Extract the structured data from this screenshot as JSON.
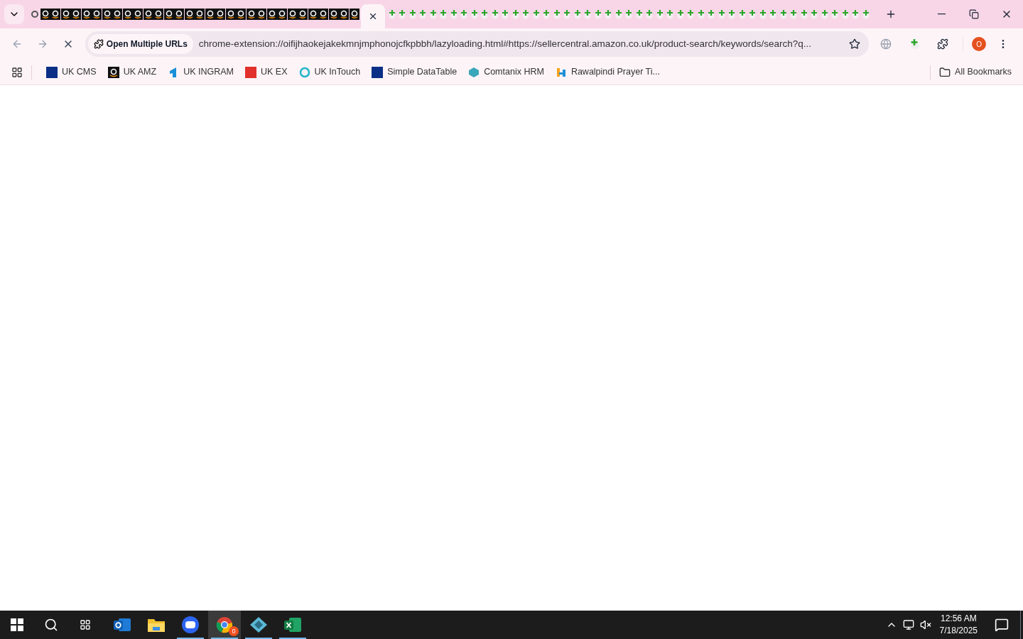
{
  "tab_strip": {
    "tabs": [
      {
        "kind": "chrome",
        "selected": false
      },
      {
        "kind": "amazon",
        "selected": false
      },
      {
        "kind": "amazon",
        "selected": false
      },
      {
        "kind": "amazon",
        "selected": false
      },
      {
        "kind": "amazon",
        "selected": false
      },
      {
        "kind": "amazon",
        "selected": false
      },
      {
        "kind": "amazon",
        "selected": false
      },
      {
        "kind": "amazon",
        "selected": false
      },
      {
        "kind": "amazon",
        "selected": false
      },
      {
        "kind": "amazon",
        "selected": false
      },
      {
        "kind": "amazon",
        "selected": false
      },
      {
        "kind": "amazon",
        "selected": false
      },
      {
        "kind": "amazon",
        "selected": false
      },
      {
        "kind": "amazon",
        "selected": false
      },
      {
        "kind": "amazon",
        "selected": false
      },
      {
        "kind": "amazon",
        "selected": false
      },
      {
        "kind": "amazon",
        "selected": false
      },
      {
        "kind": "amazon",
        "selected": false
      },
      {
        "kind": "amazon",
        "selected": false
      },
      {
        "kind": "amazon",
        "selected": false
      },
      {
        "kind": "amazon",
        "selected": false
      },
      {
        "kind": "amazon",
        "selected": false
      },
      {
        "kind": "amazon",
        "selected": false
      },
      {
        "kind": "amazon",
        "selected": false
      },
      {
        "kind": "amazon",
        "selected": false
      },
      {
        "kind": "amazon",
        "selected": false
      },
      {
        "kind": "amazon",
        "selected": false
      },
      {
        "kind": "amazon",
        "selected": false
      },
      {
        "kind": "amazon",
        "selected": false
      },
      {
        "kind": "amazon",
        "selected": false
      },
      {
        "kind": "amazon",
        "selected": false
      },
      {
        "kind": "amazon",
        "selected": false
      },
      {
        "selected": true
      },
      {
        "kind": "extension",
        "selected": false
      },
      {
        "kind": "extension",
        "selected": false
      },
      {
        "kind": "extension",
        "selected": false
      },
      {
        "kind": "extension",
        "selected": false
      },
      {
        "kind": "extension",
        "selected": false
      },
      {
        "kind": "extension",
        "selected": false
      },
      {
        "kind": "extension",
        "selected": false
      },
      {
        "kind": "extension",
        "selected": false
      },
      {
        "kind": "extension",
        "selected": false
      },
      {
        "kind": "extension",
        "selected": false
      },
      {
        "kind": "extension",
        "selected": false
      },
      {
        "kind": "extension",
        "selected": false
      },
      {
        "kind": "extension",
        "selected": false
      },
      {
        "kind": "extension",
        "selected": false
      },
      {
        "kind": "extension",
        "selected": false
      },
      {
        "kind": "extension",
        "selected": false
      },
      {
        "kind": "extension",
        "selected": false
      },
      {
        "kind": "extension",
        "selected": false
      },
      {
        "kind": "extension",
        "selected": false
      },
      {
        "kind": "extension",
        "selected": false
      },
      {
        "kind": "extension",
        "selected": false
      },
      {
        "kind": "extension",
        "selected": false
      },
      {
        "kind": "extension",
        "selected": false
      },
      {
        "kind": "extension",
        "selected": false
      },
      {
        "kind": "extension",
        "selected": false
      },
      {
        "kind": "extension",
        "selected": false
      },
      {
        "kind": "extension",
        "selected": false
      },
      {
        "kind": "extension",
        "selected": false
      },
      {
        "kind": "extension",
        "selected": false
      },
      {
        "kind": "extension",
        "selected": false
      },
      {
        "kind": "extension",
        "selected": false
      },
      {
        "kind": "extension",
        "selected": false
      },
      {
        "kind": "extension",
        "selected": false
      },
      {
        "kind": "extension",
        "selected": false
      },
      {
        "kind": "extension",
        "selected": false
      },
      {
        "kind": "extension",
        "selected": false
      },
      {
        "kind": "extension",
        "selected": false
      },
      {
        "kind": "extension",
        "selected": false
      },
      {
        "kind": "extension",
        "selected": false
      },
      {
        "kind": "extension",
        "selected": false
      },
      {
        "kind": "extension",
        "selected": false
      },
      {
        "kind": "extension",
        "selected": false
      },
      {
        "kind": "extension",
        "selected": false
      },
      {
        "kind": "extension",
        "selected": false
      },
      {
        "kind": "extension",
        "selected": false
      },
      {
        "kind": "extension",
        "selected": false
      },
      {
        "kind": "extension",
        "selected": false
      }
    ]
  },
  "toolbar": {
    "site_chip": "Open Multiple URLs",
    "url": "chrome-extension://oifijhaokejakekmnjmphonojcfkpbbh/lazyloading.html#https://sellercentral.amazon.co.uk/product-search/keywords/search?q...",
    "profile_initial": "O"
  },
  "bookmarks": {
    "items": [
      {
        "label": "UK CMS",
        "kind": "df"
      },
      {
        "label": "UK AMZ",
        "kind": "amazon"
      },
      {
        "label": "UK INGRAM",
        "kind": "ingram"
      },
      {
        "label": "UK EX",
        "kind": "ex"
      },
      {
        "label": "UK InTouch",
        "kind": "intouch"
      },
      {
        "label": "Simple DataTable",
        "kind": "df"
      },
      {
        "label": "Comtanix HRM",
        "kind": "hex"
      },
      {
        "label": "Rawalpindi Prayer Ti...",
        "kind": "h"
      }
    ],
    "all_bookmarks": "All Bookmarks"
  },
  "taskbar": {
    "apps": [
      {
        "kind": "outlook",
        "running": false,
        "selected": false
      },
      {
        "kind": "explorer",
        "running": false,
        "selected": false
      },
      {
        "kind": "zoom",
        "running": true,
        "selected": false
      },
      {
        "kind": "chrome",
        "running": true,
        "selected": true,
        "badge": "0"
      },
      {
        "kind": "diamond",
        "running": true,
        "selected": false
      },
      {
        "kind": "excel",
        "running": true,
        "selected": false
      }
    ],
    "time": "12:56 AM",
    "date": "7/18/2025"
  }
}
